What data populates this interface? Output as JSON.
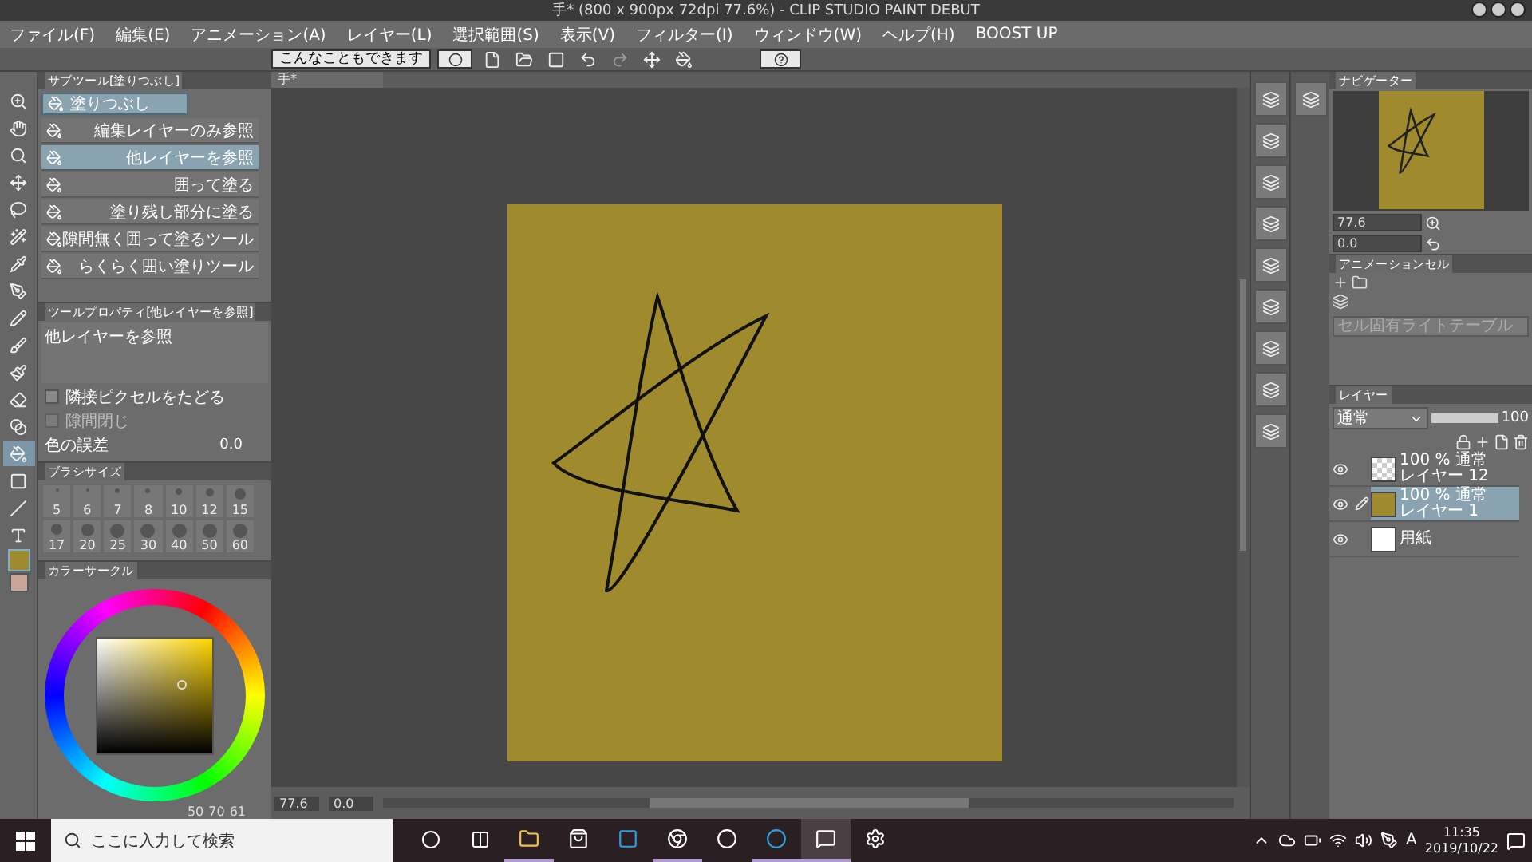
{
  "window": {
    "title": "手* (800 x 900px 72dpi 77.6%) - CLIP STUDIO PAINT DEBUT"
  },
  "menu": [
    "ファイル(F)",
    "編集(E)",
    "アニメーション(A)",
    "レイヤー(L)",
    "選択範囲(S)",
    "表示(V)",
    "フィルター(I)",
    "ウィンドウ(W)",
    "ヘルプ(H)",
    "BOOST UP"
  ],
  "command_bar": {
    "tip_button": "こんなこともできます"
  },
  "subtool_panel": {
    "title": "サブツール[塗りつぶし]",
    "group": "塗りつぶし",
    "items": [
      {
        "label": "編集レイヤーのみ参照",
        "selected": false
      },
      {
        "label": "他レイヤーを参照",
        "selected": true
      },
      {
        "label": "囲って塗る",
        "selected": false
      },
      {
        "label": "塗り残し部分に塗る",
        "selected": false
      },
      {
        "label": "隙間無く囲って塗るツール",
        "selected": false
      },
      {
        "label": "らくらく囲い塗りツール",
        "selected": false
      }
    ]
  },
  "tool_property": {
    "title": "ツールプロパティ[他レイヤーを参照]",
    "name": "他レイヤーを参照",
    "options": [
      {
        "kind": "checkbox",
        "label": "隣接ピクセルをたどる",
        "checked": false,
        "disabled": false
      },
      {
        "kind": "checkbox",
        "label": "隙間閉じ",
        "checked": false,
        "disabled": true
      },
      {
        "kind": "number",
        "label": "色の誤差",
        "value": "0.0"
      }
    ]
  },
  "brush_size": {
    "title": "ブラシサイズ",
    "sizes": [
      "5",
      "6",
      "7",
      "8",
      "10",
      "12",
      "15",
      "17",
      "20",
      "25",
      "30",
      "40",
      "50",
      "60"
    ]
  },
  "color_circle": {
    "title": "カラーサークル",
    "values": [
      "50",
      "70",
      "61"
    ]
  },
  "canvas": {
    "tab": "手*",
    "zoom": "77.6",
    "rotation": "0.0"
  },
  "navigator": {
    "title": "ナビゲーター",
    "zoom": "77.6",
    "rotation": "0.0"
  },
  "animation_cel": {
    "title": "アニメーションセル",
    "lighttable": "セル固有ライトテーブル"
  },
  "layer_panel": {
    "title": "レイヤー",
    "blend_mode": "通常",
    "opacity_slider": {
      "level": 1
    },
    "opacity": "100",
    "layers": [
      {
        "kind": "raster",
        "mode": "100 % 通常",
        "name": "レイヤー 12",
        "selected": false
      },
      {
        "kind": "raster",
        "mode": "100 % 通常",
        "name": "レイヤー 1",
        "selected": true
      },
      {
        "kind": "paper",
        "name": "用紙",
        "selected": false
      }
    ]
  },
  "taskbar": {
    "search_placeholder": "ここに入力して検索",
    "ime": "A",
    "time": "11:35",
    "date": "2019/10/22"
  }
}
